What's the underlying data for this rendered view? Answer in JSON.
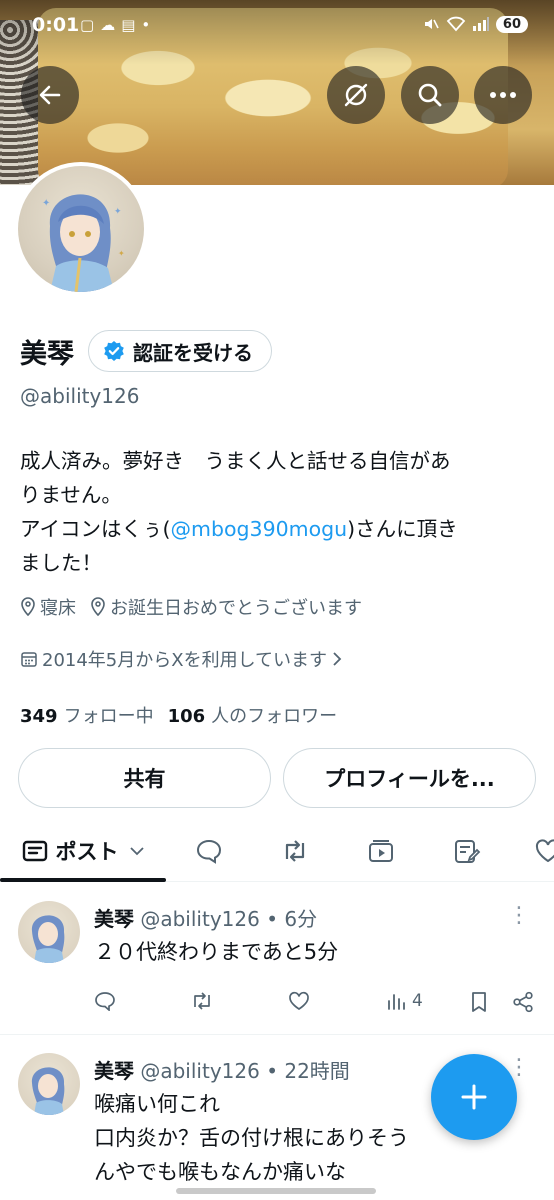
{
  "status_bar": {
    "time": "0:01",
    "left_icons": [
      "screenshot-icon",
      "cloud-icon",
      "calendar-icon",
      "dot-icon"
    ],
    "right_icons": [
      "mute-icon",
      "wifi-icon",
      "signal-icon"
    ],
    "battery": "60"
  },
  "profile": {
    "display_name": "美琴",
    "verify_label": "認証を受ける",
    "handle": "@ability126",
    "bio_line1": "成人済み。夢好き　うまく人と話せる自信があ",
    "bio_line2": "りません。",
    "bio_line3_pre": "アイコンはくぅ(",
    "bio_mention": "@mbog390mogu",
    "bio_line3_post": ")さんに頂き",
    "bio_line4": "ました！",
    "location": "寝床",
    "website": "お誕生日おめでとうございます",
    "joined": "2014年5月からXを利用しています",
    "following_count": "349",
    "following_label": "フォロー中",
    "followers_count": "106",
    "followers_label": "人のフォロワー",
    "share_label": "共有",
    "edit_profile_label": "プロフィールを..."
  },
  "tabs": {
    "posts_label": "ポスト"
  },
  "posts": [
    {
      "name": "美琴",
      "handle": "@ability126",
      "time": "6分",
      "text": [
        "２０代終わりまであと5分"
      ],
      "views": "4"
    },
    {
      "name": "美琴",
      "handle": "@ability126",
      "time": "22時間",
      "text": [
        "喉痛い何これ",
        "口内炎か？舌の付け根にありそう",
        "んやでも喉もなんか痛いな"
      ]
    }
  ],
  "colors": {
    "accent": "#1d9bf0",
    "text": "#0f1419",
    "secondary": "#536471",
    "border": "#cfd9de"
  }
}
